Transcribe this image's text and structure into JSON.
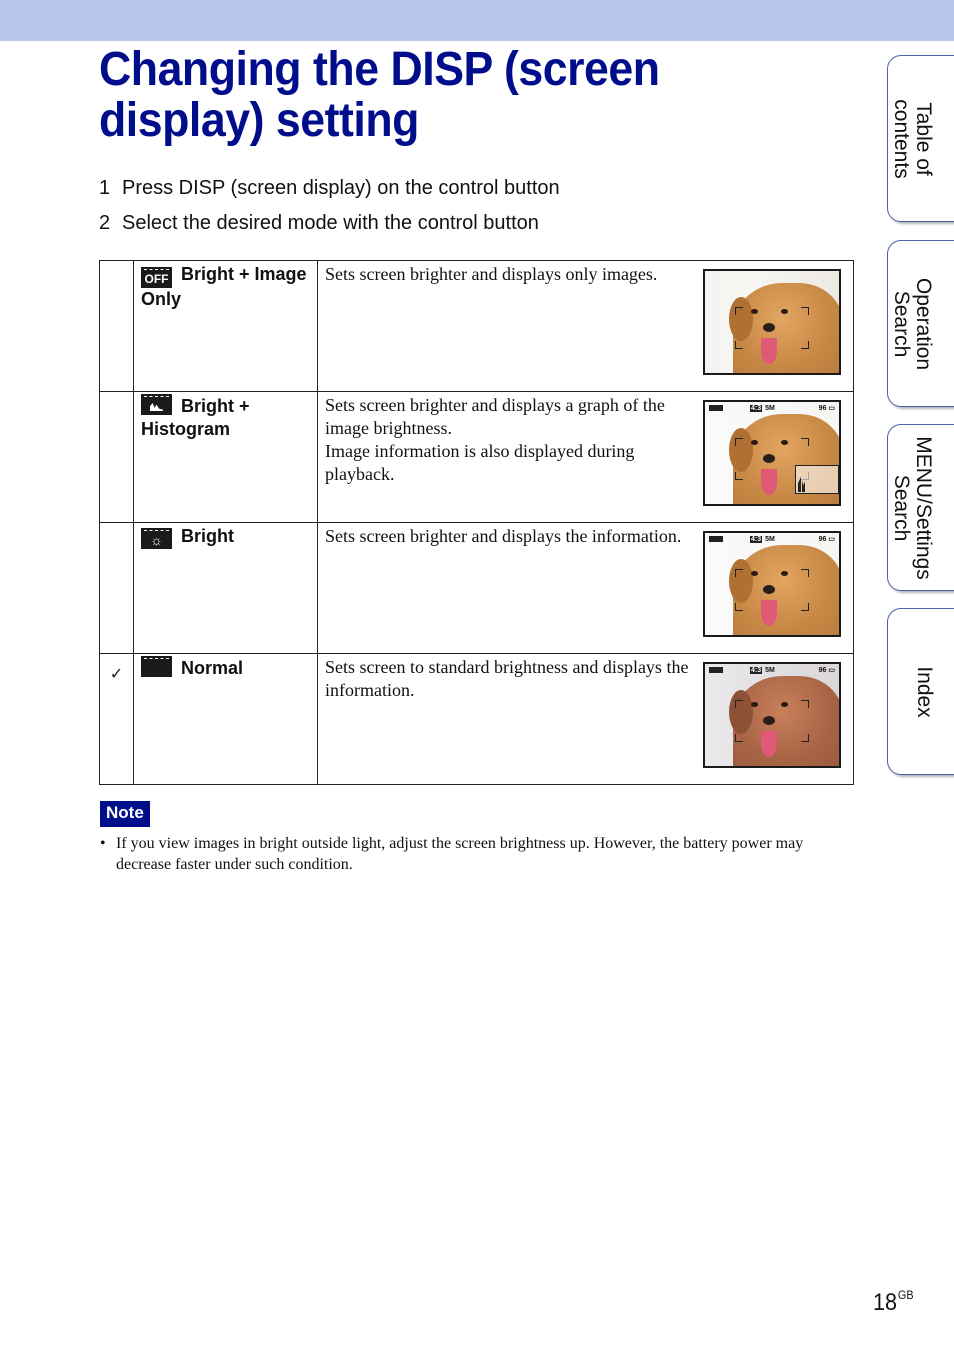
{
  "page": {
    "title": "Changing the DISP (screen display) setting",
    "page_number": "18",
    "page_suffix": "GB"
  },
  "steps": [
    {
      "num": "1",
      "text": "Press DISP (screen display) on the control button"
    },
    {
      "num": "2",
      "text": "Select the desired mode with the control button"
    }
  ],
  "modes": [
    {
      "icon": "bright-image-only-icon",
      "icon_text": "OFF",
      "name": "Bright + Image Only",
      "description": [
        "Sets screen brighter and displays only images."
      ],
      "selected": false
    },
    {
      "icon": "bright-histogram-icon",
      "icon_text": "",
      "name": "Bright + Histogram",
      "description": [
        "Sets screen brighter and displays a graph of the image brightness.",
        "Image information is also displayed during playback."
      ],
      "selected": false
    },
    {
      "icon": "bright-icon",
      "icon_text": "☼",
      "name": "Bright",
      "description": [
        "Sets screen brighter and displays the information."
      ],
      "selected": false
    },
    {
      "icon": "normal-icon",
      "icon_text": "",
      "name": "Normal",
      "description": [
        "Sets screen to standard brightness and displays the information."
      ],
      "selected": true
    }
  ],
  "osd": {
    "aspect": "4:3",
    "size": "5M",
    "count": "96"
  },
  "default_mark": "✓",
  "note": {
    "label": "Note",
    "items": [
      "If you view images in bright outside light, adjust the screen brightness up. However, the battery power may decrease faster under such condition."
    ]
  },
  "side_tabs": [
    {
      "label_line1": "Table of",
      "label_line2": "contents"
    },
    {
      "label_line1": "Operation",
      "label_line2": "Search"
    },
    {
      "label_line1": "MENU/Settings",
      "label_line2": "Search"
    },
    {
      "label_line1": "Index",
      "label_line2": ""
    }
  ]
}
